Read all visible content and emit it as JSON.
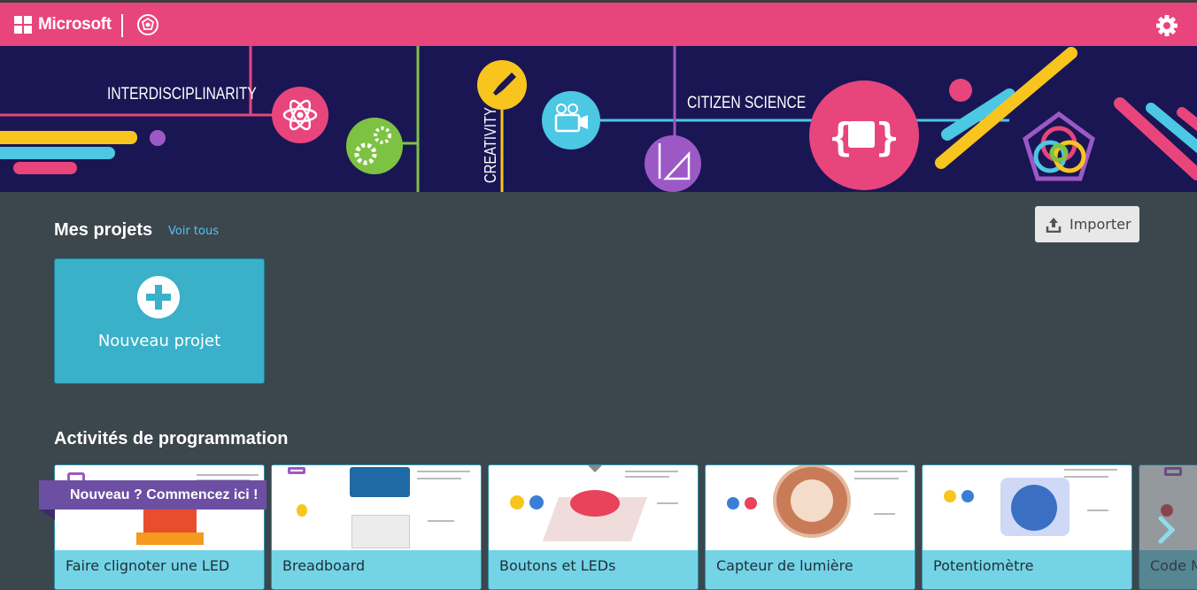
{
  "header": {
    "brand": "Microsoft",
    "logo_icon": "windows-logo-icon",
    "app_icon": "makecode-badge-icon",
    "settings_icon": "gear-icon"
  },
  "banner": {
    "labels": {
      "interdisciplinarity": "INTERDISCIPLINARITY",
      "creativity": "CREATIVITY",
      "citizen_science": "CITIZEN SCIENCE"
    }
  },
  "projects": {
    "title": "Mes projets",
    "see_all": "Voir tous",
    "import_label": "Importer",
    "new_project_label": "Nouveau projet"
  },
  "activities": {
    "title": "Activités de programmation",
    "ribbon": "Nouveau ? Commencez ici !",
    "cards": [
      {
        "title": "Faire clignoter une LED"
      },
      {
        "title": "Breadboard"
      },
      {
        "title": "Boutons et LEDs"
      },
      {
        "title": "Capteur de lumière"
      },
      {
        "title": "Potentiomètre"
      },
      {
        "title": "Code M"
      }
    ]
  },
  "colors": {
    "header_pink": "#e8457d",
    "banner_navy": "#1a1653",
    "page_bg": "#3c464d",
    "card_teal": "#3ab0c9",
    "ribbon_purple": "#6c4fa3"
  }
}
